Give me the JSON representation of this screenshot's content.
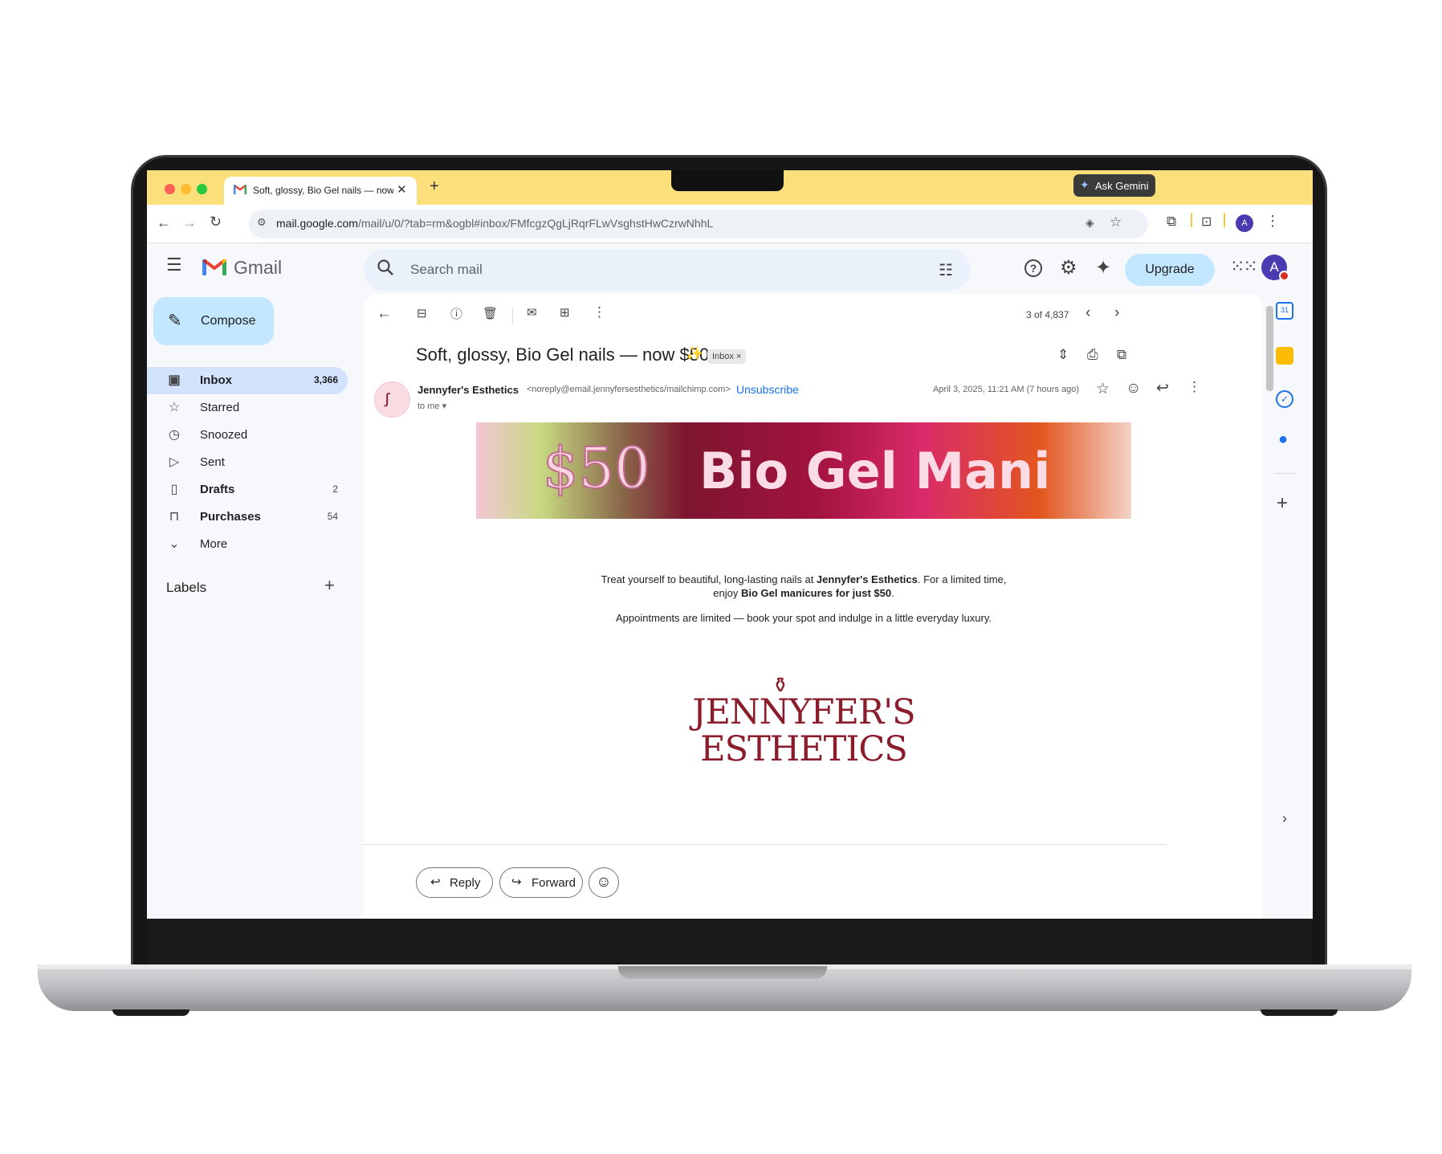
{
  "browser": {
    "tab_title": "Soft, glossy, Bio Gel nails — now",
    "new_tab": "+",
    "url_domain": "mail.google.com",
    "url_path": "/mail/u/0/?tab=rm&ogbl#inbox/FMfcgzQgLjRqrFLwVsghstHwCzrwNhhL",
    "ask_gemini": "Ask Gemini",
    "profile_initial": "A"
  },
  "gmail": {
    "product_name": "Gmail",
    "search_placeholder": "Search mail",
    "upgrade_label": "Upgrade",
    "account_initial": "A",
    "compose_label": "Compose",
    "nav": [
      {
        "label": "Inbox",
        "count": "3,366",
        "icon": "inbox-icon"
      },
      {
        "label": "Starred",
        "count": "",
        "icon": "star-icon"
      },
      {
        "label": "Snoozed",
        "count": "",
        "icon": "clock-icon"
      },
      {
        "label": "Sent",
        "count": "",
        "icon": "send-icon"
      },
      {
        "label": "Drafts",
        "count": "2",
        "icon": "draft-icon"
      },
      {
        "label": "Purchases",
        "count": "54",
        "icon": "bag-icon"
      },
      {
        "label": "More",
        "count": "",
        "icon": "chevron-down-icon"
      }
    ],
    "labels_heading": "Labels"
  },
  "message": {
    "pager": "3 of 4,837",
    "subject": "Soft, glossy, Bio Gel nails — now $50",
    "inbox_chip": "Inbox",
    "sender_name": "Jennyfer's Esthetics",
    "sender_email": "<noreply@email.jennyfersesthetics/mailchimp.com>",
    "unsubscribe": "Unsubscribe",
    "date": "April 3, 2025, 11:21 AM (7 hours ago)",
    "to_me": "to me",
    "banner_price": "$50",
    "banner_text": "Bio Gel Mani",
    "body_p1_a": "Treat yourself to beautiful, long-lasting nails at ",
    "body_p1_b": "Jennyfer's Esthetics",
    "body_p1_c": ". For a limited time,",
    "body_p1_d": "enjoy ",
    "body_p1_e": "Bio Gel manicures for just $50",
    "body_p1_f": ".",
    "body_p2": "Appointments are limited — book your spot and indulge in a little everyday luxury.",
    "logo_line1": "JENNYFER'S",
    "logo_line2": "ESTHETICS",
    "reply_label": "Reply",
    "forward_label": "Forward"
  },
  "colors": {
    "tabbar": "#fbdf7b",
    "accent_blue": "#1a73e8",
    "selected_nav": "#d3e3fd",
    "compose_bg": "#c2e7ff",
    "brand_maroon": "#8a1c2b"
  }
}
